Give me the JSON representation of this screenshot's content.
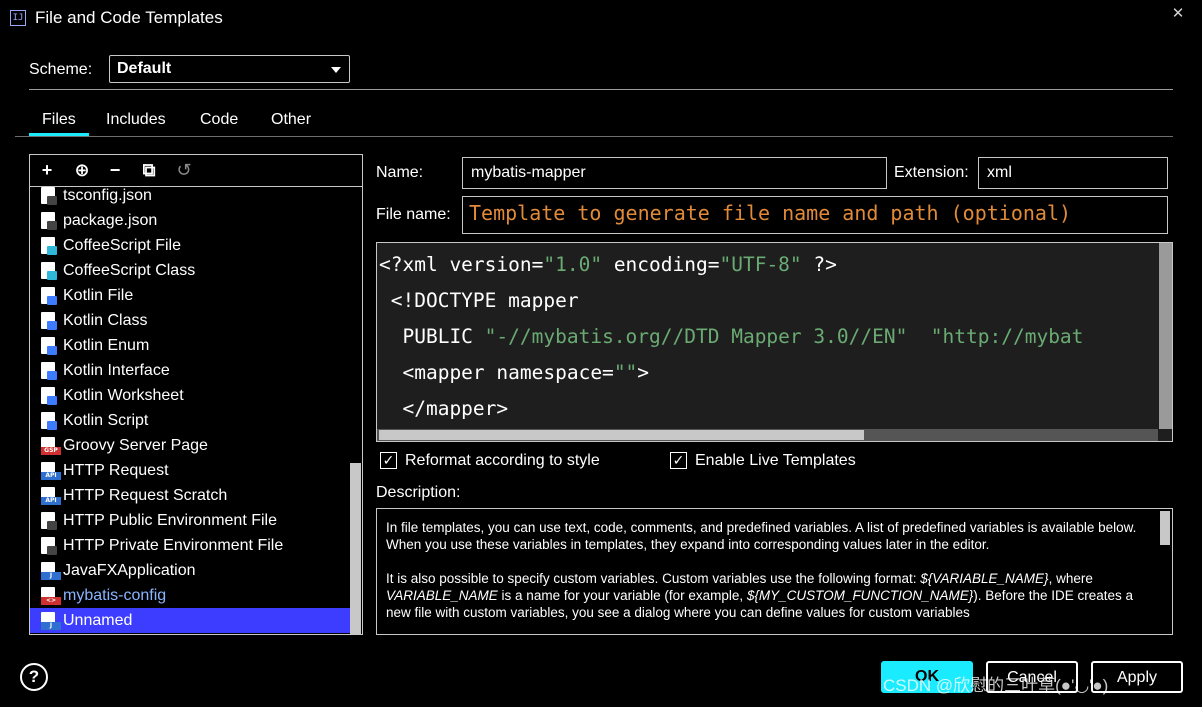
{
  "window": {
    "title": "File and Code Templates",
    "app_icon": "IJ",
    "close_glyph": "✕"
  },
  "scheme": {
    "label": "Scheme:",
    "value": "Default"
  },
  "tabs": [
    {
      "label": "Files",
      "active": true
    },
    {
      "label": "Includes",
      "active": false
    },
    {
      "label": "Code",
      "active": false
    },
    {
      "label": "Other",
      "active": false
    }
  ],
  "toolbar": {
    "add": "+",
    "add_child": "⊕",
    "remove": "−",
    "copy": "⧉",
    "reset": "↺"
  },
  "file_list": [
    {
      "label": "tsconfig.json",
      "icon": "json-file-icon",
      "badge": "#444444"
    },
    {
      "label": "package.json",
      "icon": "json-file-icon",
      "badge": "#444444"
    },
    {
      "label": "CoffeeScript File",
      "icon": "coffeescript-file-icon",
      "badge": "#2fb7d9"
    },
    {
      "label": "CoffeeScript Class",
      "icon": "coffeescript-class-icon",
      "badge": "#2fb7d9"
    },
    {
      "label": "Kotlin File",
      "icon": "kotlin-file-icon",
      "badge": "#3d7bff"
    },
    {
      "label": "Kotlin Class",
      "icon": "kotlin-class-icon",
      "badge": "#3d7bff"
    },
    {
      "label": "Kotlin Enum",
      "icon": "kotlin-enum-icon",
      "badge": "#3d7bff"
    },
    {
      "label": "Kotlin Interface",
      "icon": "kotlin-interface-icon",
      "badge": "#3d7bff"
    },
    {
      "label": "Kotlin Worksheet",
      "icon": "kotlin-worksheet-icon",
      "badge": "#3d7bff"
    },
    {
      "label": "Kotlin Script",
      "icon": "kotlin-script-icon",
      "badge": "#3d7bff"
    },
    {
      "label": "Groovy Server Page",
      "icon": "gsp-file-icon",
      "tag": "GSP",
      "tag_color": "#d03030"
    },
    {
      "label": "HTTP Request",
      "icon": "http-request-icon",
      "tag": "API",
      "tag_color": "#2f6fd0"
    },
    {
      "label": "HTTP Request Scratch",
      "icon": "http-request-scratch-icon",
      "tag": "API",
      "tag_color": "#2f6fd0"
    },
    {
      "label": "HTTP Public Environment File",
      "icon": "json-file-icon",
      "badge": "#444444"
    },
    {
      "label": "HTTP Private Environment File",
      "icon": "json-file-icon",
      "badge": "#444444"
    },
    {
      "label": "JavaFXApplication",
      "icon": "java-file-icon",
      "tag": "J",
      "tag_color": "#2f6fd0"
    },
    {
      "label": "mybatis-config",
      "icon": "xml-file-icon",
      "tag": "<>",
      "tag_color": "#d03030",
      "highlight": true
    },
    {
      "label": "Unnamed",
      "icon": "java-file-icon",
      "tag": "J",
      "tag_color": "#2f6fd0",
      "selected": true
    }
  ],
  "form": {
    "name_label": "Name:",
    "name_value": "mybatis-mapper",
    "extension_label": "Extension:",
    "extension_value": "xml",
    "filename_label": "File name:",
    "filename_placeholder": "Template to generate file name and path (optional)"
  },
  "code": {
    "lines": [
      [
        {
          "t": "<?xml version="
        },
        {
          "t": "\"1.0\"",
          "s": true
        },
        {
          "t": " encoding="
        },
        {
          "t": "\"UTF-8\"",
          "s": true
        },
        {
          "t": " ?>"
        }
      ],
      [
        {
          "t": " <!DOCTYPE mapper"
        }
      ],
      [
        {
          "t": "  PUBLIC "
        },
        {
          "t": "\"-//mybatis.org//DTD Mapper 3.0//EN\"",
          "s": true
        },
        {
          "t": "  "
        },
        {
          "t": "\"http://mybat",
          "s": true
        }
      ],
      [
        {
          "t": "  <mapper namespace="
        },
        {
          "t": "\"\"",
          "s": true
        },
        {
          "t": ">"
        }
      ],
      [
        {
          "t": "  </mapper>"
        }
      ]
    ]
  },
  "options": {
    "reformat_label": "Reformat according to style",
    "reformat_checked": true,
    "live_templates_label": "Enable Live Templates",
    "live_templates_checked": true
  },
  "description": {
    "label": "Description:",
    "para1": "In file templates, you can use text, code, comments, and predefined variables. A list of predefined variables is available below. When you use these variables in templates, they expand into corresponding values later in the editor.",
    "para2_a": "It is also possible to specify custom variables. Custom variables use the following format: ",
    "para2_var1": "${VARIABLE_NAME}",
    "para2_b": ", where ",
    "para2_var2": "VARIABLE_NAME",
    "para2_c": " is a name for your variable (for example, ",
    "para2_var3": "${MY_CUSTOM_FUNCTION_NAME}",
    "para2_d": "). Before the IDE creates a new file with custom variables, you see a dialog where you can define values for custom variables"
  },
  "buttons": {
    "help": "?",
    "ok": "OK",
    "cancel": "Cancel",
    "apply": "Apply"
  },
  "watermark": "CSDN @欣慰的三叶草(●'◡'●)"
}
